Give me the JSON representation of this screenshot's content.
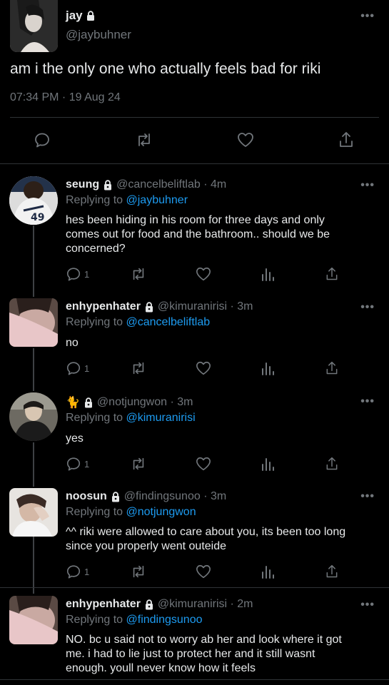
{
  "main_tweet": {
    "name": "jay",
    "handle": "@jaybuhner",
    "text": "am i the only one who actually feels bad for riki",
    "timestamp": "07:34 PM · 19 Aug 24",
    "more": "•••"
  },
  "replies": [
    {
      "name": "seung",
      "handle": "@cancelbeliftlab · 4m",
      "replying_prefix": "Replying to",
      "replying_to": "@jaybuhner",
      "text_lines": [
        "hes been hiding in his room for three days and only",
        "comes out for food and the bathroom.. should we be",
        "concerned?"
      ],
      "reply_count": "1",
      "more": "•••"
    },
    {
      "name": "enhypenhater",
      "handle": "@kimuranirisi · 3m",
      "replying_prefix": "Replying to",
      "replying_to": "@cancelbeliftlab",
      "text_lines": [
        "no"
      ],
      "reply_count": "1",
      "more": "•••"
    },
    {
      "name": "🐈",
      "handle": "@notjungwon · 3m",
      "replying_prefix": "Replying to",
      "replying_to": "@kimuranirisi",
      "text_lines": [
        "yes"
      ],
      "reply_count": "1",
      "more": "•••"
    },
    {
      "name": "noosun",
      "handle": "@findingsunoo · 3m",
      "replying_prefix": "Replying to",
      "replying_to": "@notjungwon",
      "text_lines": [
        "^^ riki were allowed to care about you, its been too long",
        "since you properly went outeide"
      ],
      "reply_count": "1",
      "more": "•••"
    },
    {
      "name": "enhypenhater",
      "handle": "@kimuranirisi · 2m",
      "replying_prefix": "Replying to",
      "replying_to": "@findingsunoo",
      "text_lines": [
        "NO. bc u said not to worry ab her and look where it got",
        "me. i had to lie just to protect her and it still wasnt",
        "enough. youll never know how it feels"
      ],
      "more": "•••"
    }
  ],
  "colors": {
    "background": "#000000",
    "text": "#e7e9ea",
    "muted": "#71767b",
    "link": "#1d9bf0",
    "divider": "#2f3336"
  }
}
